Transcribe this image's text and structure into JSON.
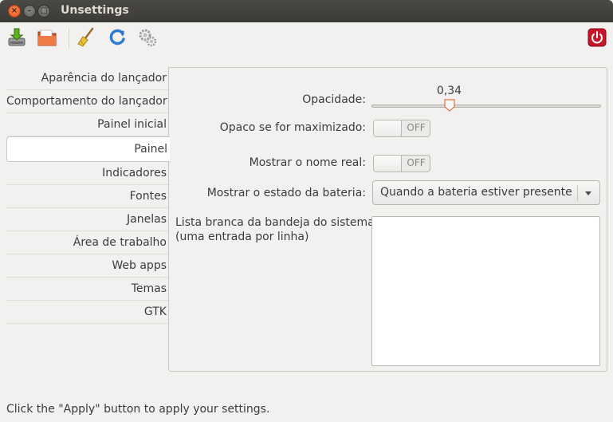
{
  "window": {
    "title": "Unsettings",
    "controls": {
      "close_icon": "×",
      "minimize_icon": "–",
      "maximize_icon": "□"
    }
  },
  "toolbar": {
    "buttons": [
      "save-icon",
      "open-folder-icon",
      "broom-icon",
      "refresh-icon",
      "settings-gears-icon",
      "power-icon"
    ]
  },
  "sidebar": {
    "items": [
      {
        "label": "Aparência do lançador"
      },
      {
        "label": "Comportamento do lançador"
      },
      {
        "label": "Painel inicial"
      },
      {
        "label": "Painel"
      },
      {
        "label": "Indicadores"
      },
      {
        "label": "Fontes"
      },
      {
        "label": "Janelas"
      },
      {
        "label": "Área de trabalho"
      },
      {
        "label": "Web apps"
      },
      {
        "label": "Temas"
      },
      {
        "label": "GTK"
      }
    ],
    "active": "Painel"
  },
  "panel": {
    "opacity": {
      "label": "Opacidade:",
      "value": 0.34,
      "display": "0,34",
      "min": 0,
      "max": 1
    },
    "opaque_maximized": {
      "label": "Opaco se for maximizado:",
      "state": "OFF"
    },
    "show_real_name": {
      "label": "Mostrar o nome real:",
      "state": "OFF"
    },
    "battery_state": {
      "label": "Mostrar o estado da bateria:",
      "selected": "Quando a bateria estiver presente"
    },
    "tray_whitelist": {
      "label_line1": "Lista branca da bandeja do sistema:",
      "label_line2": "(uma entrada por linha)",
      "value": ""
    }
  },
  "status": "Click the \"Apply\" button to apply your settings.",
  "colors": {
    "titlebar": "#3c3b37",
    "window_bg": "#f2f1f0",
    "close_button": "#e2511b",
    "power_button": "#c7162b"
  }
}
